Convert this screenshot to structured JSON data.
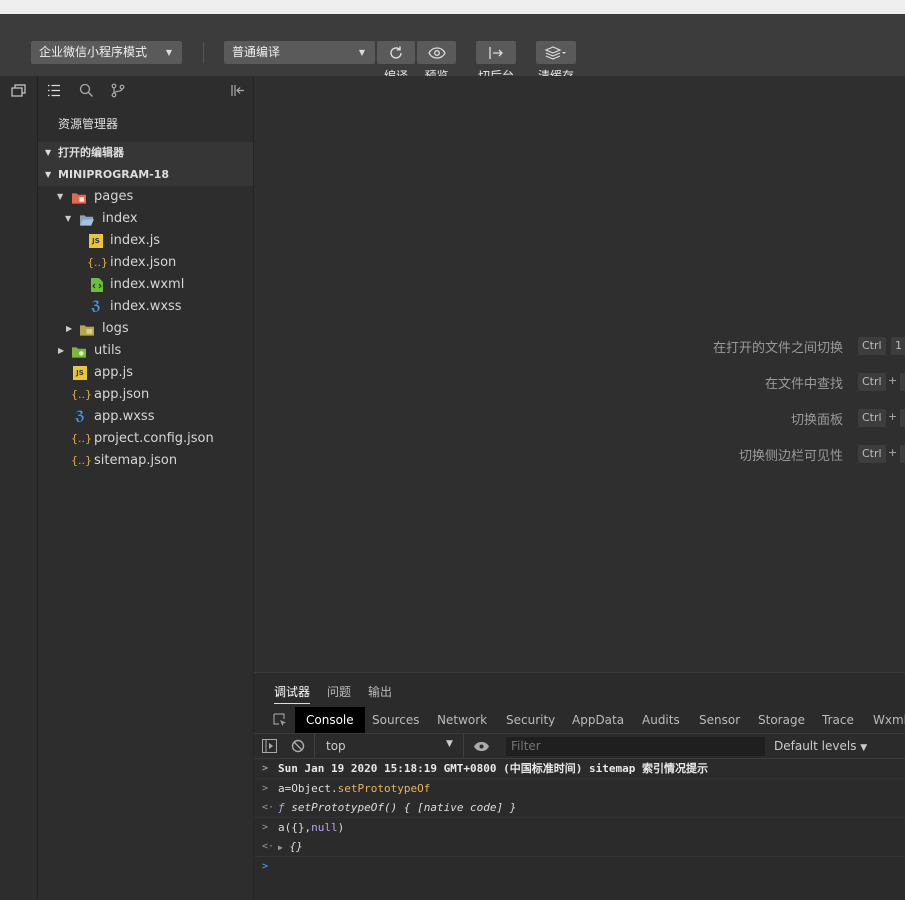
{
  "toolbar": {
    "mode_select": "企业微信小程序模式",
    "compile_select": "普通编译",
    "compile_label": "编译",
    "preview_label": "预览",
    "background_label": "切后台",
    "clear_cache_label": "清缓存"
  },
  "sidebar": {
    "title": "资源管理器",
    "open_editors": "打开的编辑器",
    "project": "MINIPROGRAM-18",
    "tree": [
      {
        "label": "pages",
        "type": "folder",
        "icon": "folder-pages-icon"
      },
      {
        "label": "index",
        "type": "folder",
        "icon": "folder-open-icon"
      },
      {
        "label": "index.js",
        "type": "js",
        "icon": "js-file-icon"
      },
      {
        "label": "index.json",
        "type": "json",
        "icon": "json-file-icon"
      },
      {
        "label": "index.wxml",
        "type": "wxml",
        "icon": "wxml-file-icon"
      },
      {
        "label": "index.wxss",
        "type": "wxss",
        "icon": "wxss-file-icon"
      },
      {
        "label": "logs",
        "type": "folder",
        "icon": "folder-icon"
      },
      {
        "label": "utils",
        "type": "folder",
        "icon": "folder-utils-icon"
      },
      {
        "label": "app.js",
        "type": "js",
        "icon": "js-file-icon"
      },
      {
        "label": "app.json",
        "type": "json",
        "icon": "json-file-icon"
      },
      {
        "label": "app.wxss",
        "type": "wxss",
        "icon": "wxss-file-icon"
      },
      {
        "label": "project.config.json",
        "type": "json",
        "icon": "json-file-icon"
      },
      {
        "label": "sitemap.json",
        "type": "json",
        "icon": "json-file-icon"
      }
    ]
  },
  "editor": {
    "hints": [
      {
        "label": "在打开的文件之间切换",
        "keys": [
          "Ctrl",
          "1"
        ]
      },
      {
        "label": "在文件中查找",
        "keys": [
          "Ctrl",
          "+"
        ]
      },
      {
        "label": "切换面板",
        "keys": [
          "Ctrl",
          "+"
        ]
      },
      {
        "label": "切换侧边栏可见性",
        "keys": [
          "Ctrl",
          "+"
        ]
      }
    ]
  },
  "debug": {
    "tabs": [
      "调试器",
      "问题",
      "输出"
    ],
    "panel_tabs": [
      "Console",
      "Sources",
      "Network",
      "Security",
      "AppData",
      "Audits",
      "Sensor",
      "Storage",
      "Trace",
      "Wxml"
    ],
    "context": "top",
    "filter_placeholder": "Filter",
    "levels": "Default levels",
    "console": {
      "line1": "Sun Jan 19 2020 15:18:19 GMT+0800 (中国标准时间) sitemap 索引情况提示",
      "line2_a": "a=Object.",
      "line2_b": "setPrototypeOf",
      "line3_f": "ƒ",
      "line3": "setPrototypeOf() { [native code] }",
      "line4_a": "a({},",
      "line4_b": "null",
      "line4_c": ")",
      "line5": "{}"
    }
  },
  "colors": {
    "accent_blue": "#4da6ff",
    "js_yellow": "#e8c63a",
    "json_orange": "#e0b040",
    "wxml_green": "#6cbf3a",
    "wxss_blue": "#3d9be9",
    "folder_red": "#e06a4c",
    "folder_green": "#7ab83a"
  }
}
